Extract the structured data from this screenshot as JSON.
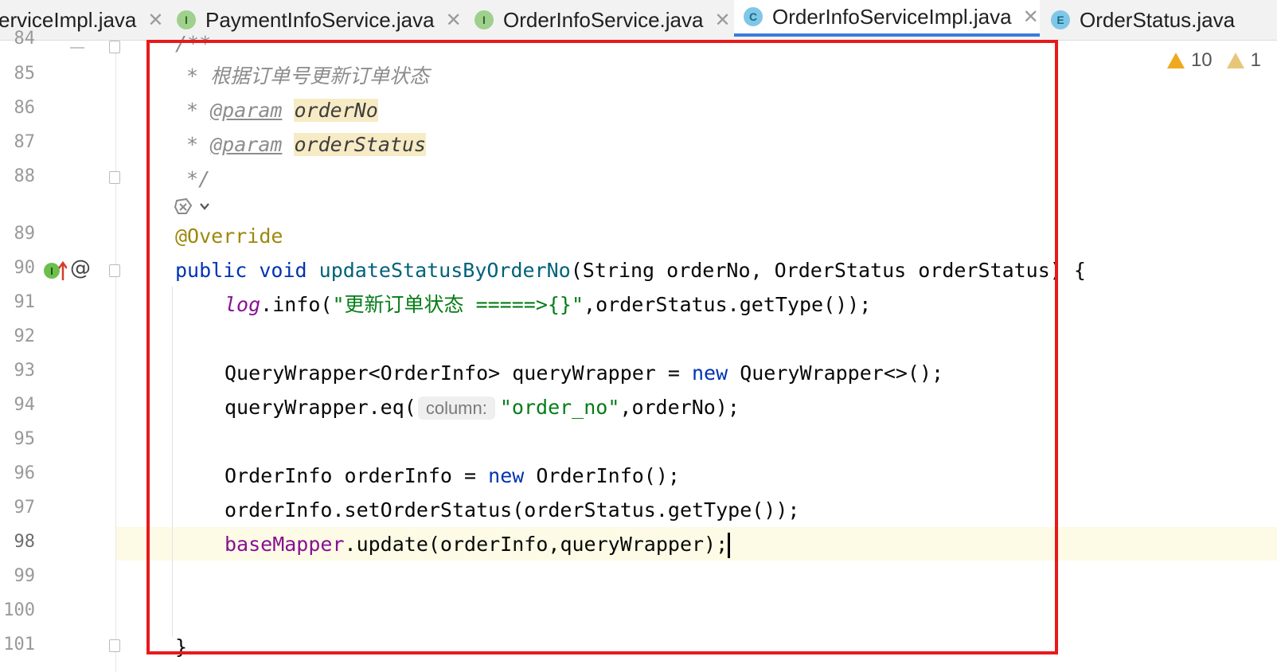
{
  "tabs": [
    {
      "label": "erviceImpl.java",
      "kind": "",
      "active": false
    },
    {
      "label": "PaymentInfoService.java",
      "kind": "I",
      "active": false
    },
    {
      "label": "OrderInfoService.java",
      "kind": "I",
      "active": false
    },
    {
      "label": "OrderInfoServiceImpl.java",
      "kind": "C",
      "active": true
    },
    {
      "label": "OrderStatus.java",
      "kind": "E",
      "active": false
    }
  ],
  "close_glyph": "✕",
  "inspections": {
    "warnings": "10",
    "weak_warnings": "1"
  },
  "line_numbers": [
    "84",
    "85",
    "86",
    "87",
    "88",
    "89",
    "90",
    "91",
    "92",
    "93",
    "94",
    "95",
    "96",
    "97",
    "98",
    "99",
    "100",
    "101"
  ],
  "current_line": "98",
  "code": {
    "l84": "/**",
    "l85_comment": "* 根据订单号更新订单状态",
    "param_star": "* ",
    "param_tag": "@param",
    "param1": "orderNo",
    "param2": "orderStatus",
    "l88": "*/",
    "l89": "@Override",
    "l90_public": "public",
    "l90_void": "void",
    "l90_method": "updateStatusByOrderNo",
    "l90_rest": "(String orderNo, OrderStatus orderStatus) {",
    "l91_log": "log",
    "l91_info": ".info(",
    "l91_str": "\"更新订单状态 =====>{}\"",
    "l91_rest": ",orderStatus.getType());",
    "l93_a": "QueryWrapper<OrderInfo> queryWrapper = ",
    "l93_new": "new",
    "l93_b": " QueryWrapper<>();",
    "l94_a": "queryWrapper.eq(",
    "l94_hint": "column:",
    "l94_str": "\"order_no\"",
    "l94_b": ",orderNo);",
    "l96_a": "OrderInfo orderInfo = ",
    "l96_new": "new",
    "l96_b": " OrderInfo();",
    "l97": "orderInfo.setOrderStatus(orderStatus.getType());",
    "l98_field": "baseMapper",
    "l98_rest": ".update(orderInfo,queryWrapper);",
    "l101": "}"
  },
  "colors": {
    "keyword": "#0033b3",
    "string": "#067d17",
    "annotation": "#9e880d",
    "field": "#871094",
    "highlight_box": "#e8191b"
  },
  "icons": [
    "interface-badge-icon",
    "class-badge-icon",
    "enum-badge-icon",
    "close-icon",
    "warning-icon",
    "weak-warning-icon",
    "implements-icon",
    "override-at-icon",
    "fold-icon",
    "ai-assist-icon"
  ]
}
